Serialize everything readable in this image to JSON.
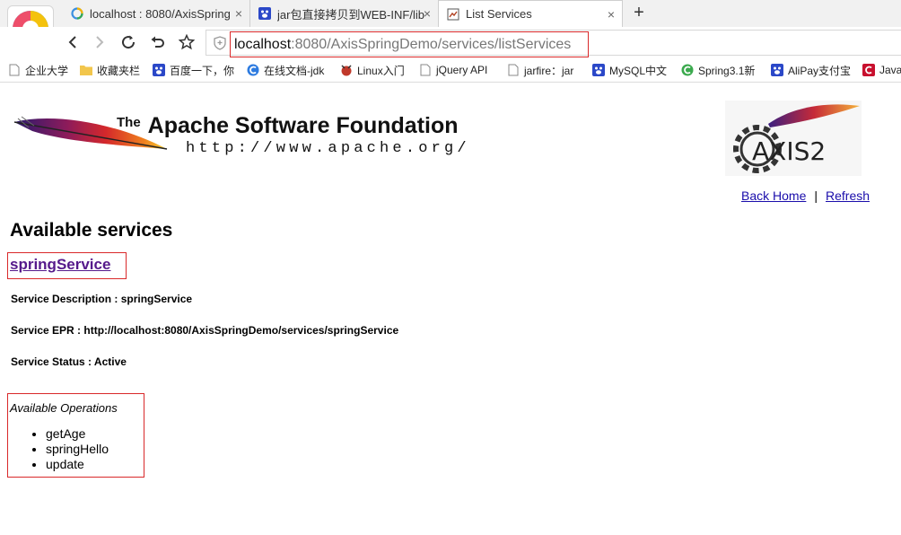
{
  "browser": {
    "tabs": [
      {
        "label": "localhost : 8080/AxisSpring",
        "icon": "search-logo-icon"
      },
      {
        "label": "jar包直接拷贝到WEB-INF/lib",
        "icon": "paw-icon"
      },
      {
        "label": "List Services",
        "icon": "page-icon"
      }
    ],
    "close_glyph": "×",
    "new_tab_glyph": "+",
    "address": {
      "host": "localhost",
      "rest": ":8080/AxisSpringDemo/services/listServices"
    },
    "bookmarks": [
      {
        "label": "企业大学",
        "icon": "page-icon"
      },
      {
        "label": "收藏夹栏",
        "icon": "folder-icon"
      },
      {
        "label": "百度一下，你",
        "icon": "paw-icon"
      },
      {
        "label": "在线文档-jdk",
        "icon": "c-icon"
      },
      {
        "label": "Linux入门",
        "icon": "fox-icon"
      },
      {
        "label": "jQuery API",
        "icon": "page-icon"
      },
      {
        "label": "jarfire：jar",
        "icon": "page-icon"
      },
      {
        "label": "MySQL中文",
        "icon": "paw-icon"
      },
      {
        "label": "Spring3.1新",
        "icon": "c-green-icon"
      },
      {
        "label": "AliPay支付宝",
        "icon": "paw-icon"
      },
      {
        "label": "Java",
        "icon": "c-red-icon"
      }
    ]
  },
  "header": {
    "apache_the": "The",
    "apache_title": "Apache Software Foundation",
    "apache_url": "http://www.apache.org/",
    "axis_logo_text": "AXIS2",
    "back_home": "Back Home",
    "separator": "|",
    "refresh": "Refresh"
  },
  "main": {
    "heading": "Available services",
    "service": {
      "name": "springService",
      "description": "Service Description : springService",
      "epr": "Service EPR : http://localhost:8080/AxisSpringDemo/services/springService",
      "status": "Service Status : Active"
    },
    "operations_title": "Available Operations",
    "operations": [
      "getAge",
      "springHello",
      "update"
    ]
  },
  "colors": {
    "highlight_box": "#d9292a",
    "link": "#1a0dab",
    "visited_link": "#551a8b"
  }
}
